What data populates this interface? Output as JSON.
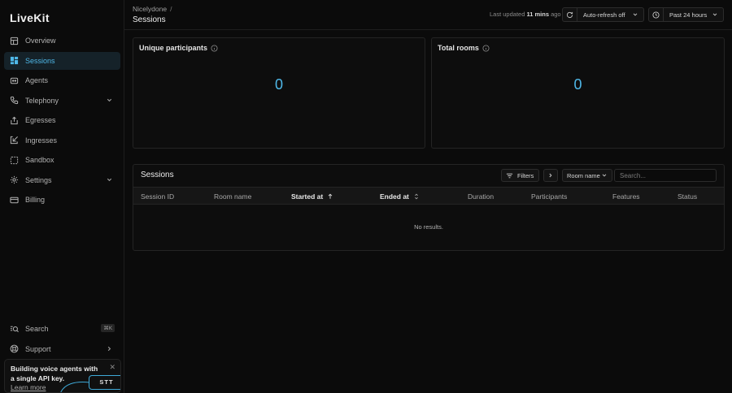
{
  "brand": {
    "logo": "LiveKit"
  },
  "nav": {
    "items": [
      {
        "label": "Overview",
        "icon": "overview-icon"
      },
      {
        "label": "Sessions",
        "icon": "sessions-icon",
        "active": true
      },
      {
        "label": "Agents",
        "icon": "agents-icon"
      },
      {
        "label": "Telephony",
        "icon": "phone-icon"
      },
      {
        "label": "Egresses",
        "icon": "egress-icon"
      },
      {
        "label": "Ingresses",
        "icon": "ingress-icon"
      },
      {
        "label": "Sandbox",
        "icon": "sandbox-icon"
      },
      {
        "label": "Settings",
        "icon": "gear-icon"
      },
      {
        "label": "Billing",
        "icon": "billing-icon"
      }
    ],
    "search_label": "Search",
    "search_shortcut": "⌘K",
    "support_label": "Support"
  },
  "promo": {
    "text": "Building voice agents with a single API key.",
    "link": "Learn more",
    "badge": "STT",
    "close": "✕"
  },
  "header": {
    "breadcrumb": "Nicelydone",
    "breadcrumb_sep": "/",
    "title": "Sessions",
    "last_updated_prefix": "Last updated",
    "last_updated_value": "11 mins",
    "last_updated_suffix": "ago",
    "auto_refresh": "Auto-refresh off",
    "time_range": "Past 24 hours"
  },
  "metrics": {
    "unique_participants": {
      "label": "Unique participants",
      "value": "0"
    },
    "total_rooms": {
      "label": "Total rooms",
      "value": "0"
    }
  },
  "sessions_table": {
    "title": "Sessions",
    "filters_label": "Filters",
    "room_name_filter": "Room name",
    "search_placeholder": "Search...",
    "columns": [
      "Session ID",
      "Room name",
      "Started at",
      "Ended at",
      "Duration",
      "Participants",
      "Features",
      "Status"
    ],
    "empty_text": "No results."
  },
  "colors": {
    "accent": "#4fb8e8",
    "active_bg": "#152229",
    "background": "#0b0b0b"
  }
}
